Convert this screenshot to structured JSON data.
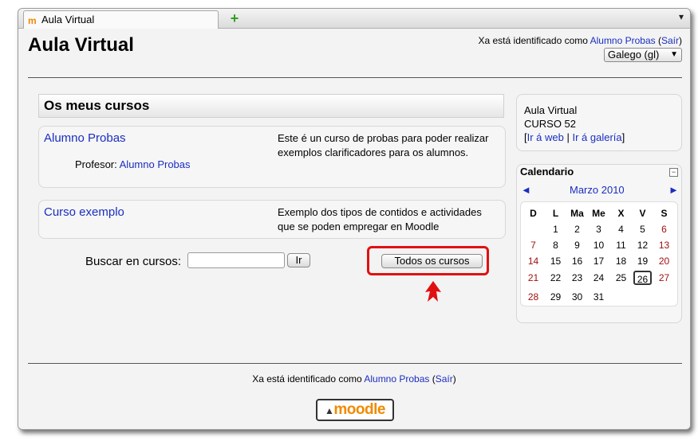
{
  "browser": {
    "tab_title": "Aula Virtual",
    "favicon_text": "m",
    "new_tab_glyph": "+",
    "menu_glyph": "▾"
  },
  "header": {
    "site_title": "Aula Virtual",
    "login_prefix": "Xa está identificado como ",
    "user_name": "Alumno Probas",
    "logout_label": "Saír",
    "language": "Galego (gl)"
  },
  "main": {
    "section_title": "Os meus cursos",
    "courses": [
      {
        "name": "Alumno Probas",
        "teacher_label": "Profesor: ",
        "teacher_name": "Alumno Probas",
        "summary": "Este é un curso de probas para poder realizar exemplos clarificadores para os alumnos."
      },
      {
        "name": "Curso exemplo",
        "summary": "Exemplo dos tipos de contidos e actividades que se poden empregar en Moodle"
      }
    ],
    "search_label": "Buscar en cursos:",
    "search_value": "",
    "search_button": "Ir",
    "all_courses_button": "Todos os cursos"
  },
  "sidebar": {
    "info": {
      "line1": "Aula Virtual",
      "line2": "CURSO 52",
      "link_web": "Ir á web",
      "link_gallery": "Ir á galería"
    },
    "calendar": {
      "title": "Calendario",
      "toggle": "−",
      "month": "Marzo 2010",
      "prev": "◄",
      "next": "►",
      "day_headers": [
        "D",
        "L",
        "Ma",
        "Me",
        "X",
        "V",
        "S"
      ],
      "weeks": [
        [
          "",
          "1",
          "2",
          "3",
          "4",
          "5",
          "6"
        ],
        [
          "7",
          "8",
          "9",
          "10",
          "11",
          "12",
          "13"
        ],
        [
          "14",
          "15",
          "16",
          "17",
          "18",
          "19",
          "20"
        ],
        [
          "21",
          "22",
          "23",
          "24",
          "25",
          "26",
          "27"
        ],
        [
          "28",
          "29",
          "30",
          "31",
          "",
          "",
          ""
        ]
      ],
      "today": "26"
    }
  },
  "footer": {
    "login_prefix": "Xa está identificado como ",
    "user_name": "Alumno Probas",
    "logout_label": "Saír",
    "logo_text": "moodle"
  },
  "colors": {
    "link": "#1a2ec0",
    "weekend": "#a01010",
    "highlight": "#e01010",
    "moodle_orange": "#f08a00"
  }
}
